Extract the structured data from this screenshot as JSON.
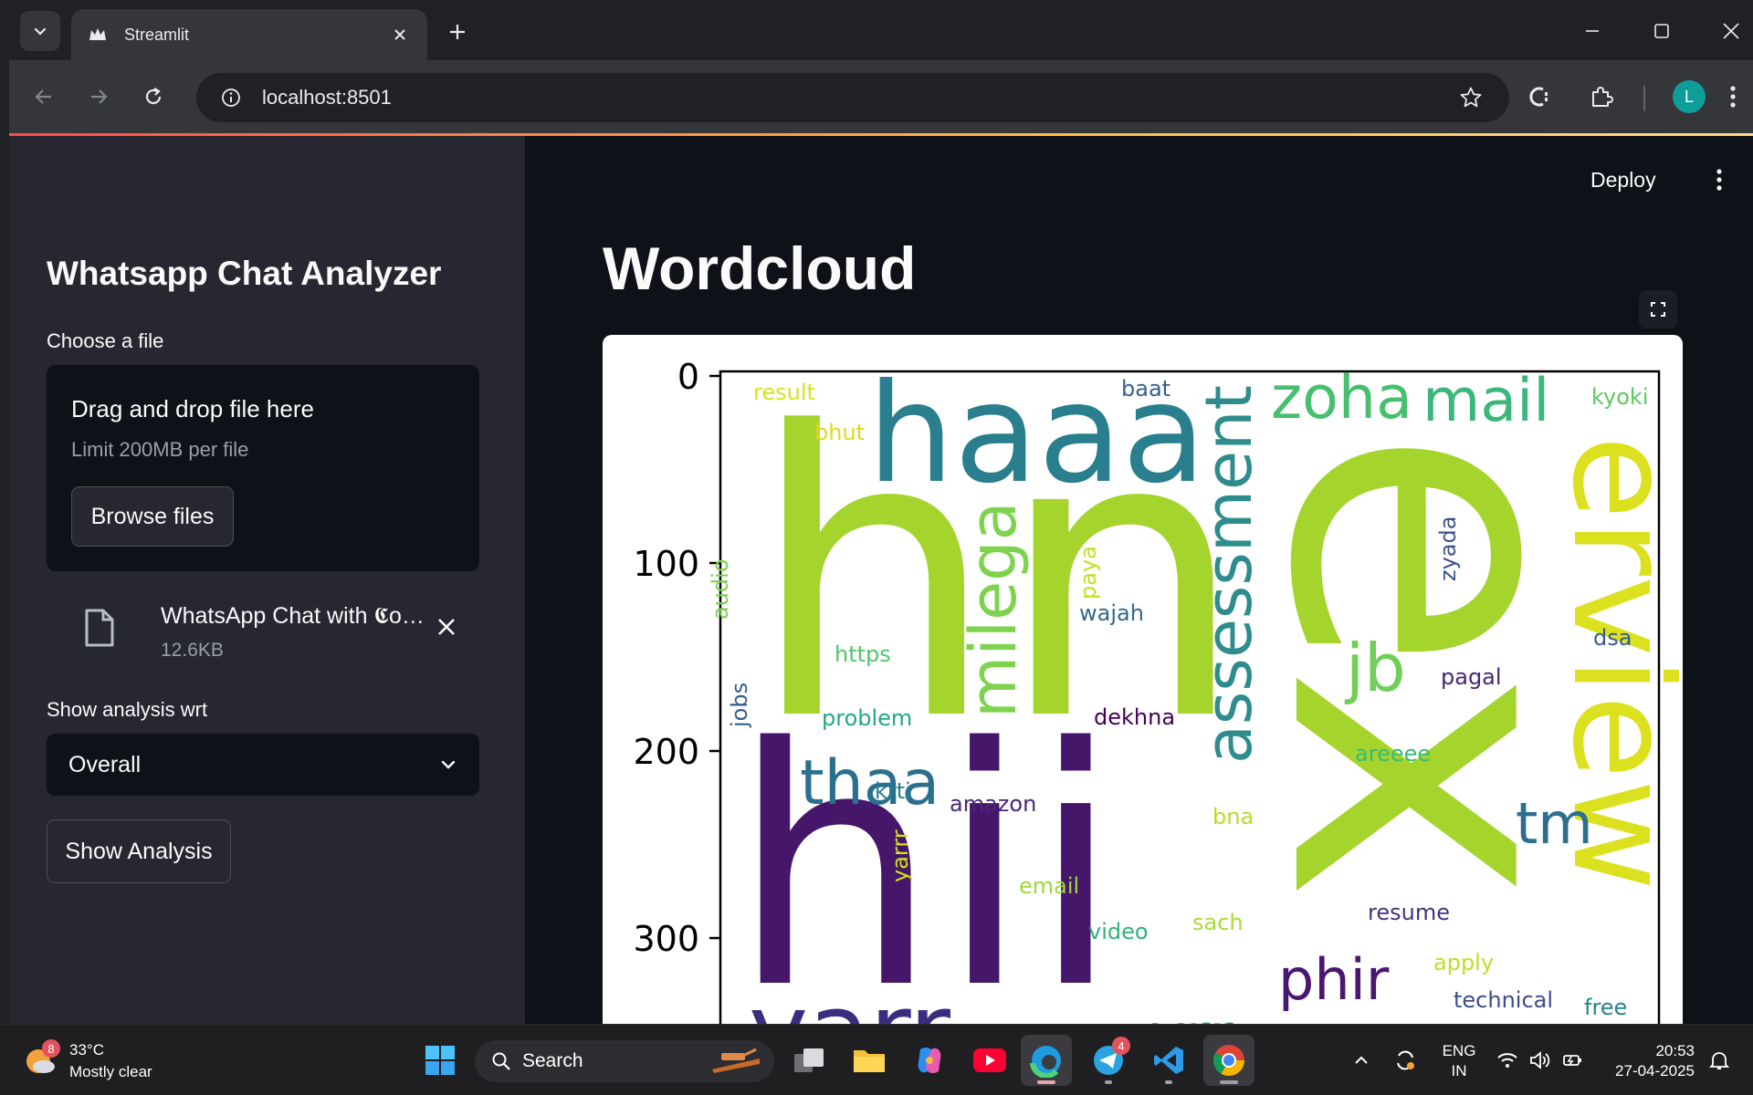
{
  "browser": {
    "tab_title": "Streamlit",
    "url": "localhost:8501",
    "profile_initial": "L"
  },
  "sidebar": {
    "title": "Whatsapp Chat Analyzer",
    "file_label": "Choose a file",
    "dropzone_title": "Drag and drop file here",
    "dropzone_limit": "Limit 200MB per file",
    "browse_label": "Browse files",
    "uploaded_file_name": "WhatsApp Chat with 𝕮o…",
    "uploaded_file_size": "12.6KB",
    "analysis_label": "Show analysis wrt",
    "analysis_selected": "Overall",
    "show_button": "Show Analysis"
  },
  "main": {
    "deploy_label": "Deploy",
    "page_title": "Wordcloud",
    "y_ticks": [
      "0",
      "100",
      "200",
      "300"
    ],
    "words": [
      {
        "text": "hn",
        "color": "#a5d42d",
        "rotate": 0
      },
      {
        "text": "haaa",
        "color": "#2a7f8e",
        "rotate": 0
      },
      {
        "text": "hii",
        "color": "#46166b",
        "rotate": 0
      },
      {
        "text": "ex",
        "color": "#a5d42d",
        "rotate": 90
      },
      {
        "text": "erview",
        "color": "#dce11f",
        "rotate": 90
      },
      {
        "text": "zoha",
        "color": "#46c06f",
        "rotate": 0
      },
      {
        "text": "mail",
        "color": "#3bb77a",
        "rotate": 0
      },
      {
        "text": "assessment",
        "color": "#2f8c8c",
        "rotate": -90
      },
      {
        "text": "milega",
        "color": "#7ed34e",
        "rotate": -90
      },
      {
        "text": "thaa",
        "color": "#2b6f8e",
        "rotate": 0
      },
      {
        "text": "jb",
        "color": "#6fcf57",
        "rotate": 0
      },
      {
        "text": "tm",
        "color": "#2d6e8d",
        "rotate": 0
      },
      {
        "text": "phir",
        "color": "#4a1770",
        "rotate": 0
      },
      {
        "text": "yarr",
        "color": "#3a2d7f",
        "rotate": 0
      },
      {
        "text": "yrr",
        "color": "#2aa083",
        "rotate": 0
      },
      {
        "text": "result",
        "color": "#d8e219",
        "rotate": 0
      },
      {
        "text": "bhut",
        "color": "#e0d81c",
        "rotate": 0
      },
      {
        "text": "baat",
        "color": "#35608d",
        "rotate": 0
      },
      {
        "text": "kyoki",
        "color": "#5ec962",
        "rotate": 0
      },
      {
        "text": "zyada",
        "color": "#3b528b",
        "rotate": -90
      },
      {
        "text": "paya",
        "color": "#c2df23",
        "rotate": -90
      },
      {
        "text": "wajah",
        "color": "#31688e",
        "rotate": 0
      },
      {
        "text": "audio",
        "color": "#7ad151",
        "rotate": -90
      },
      {
        "text": "https",
        "color": "#52c569",
        "rotate": 0
      },
      {
        "text": "dsa",
        "color": "#38598c",
        "rotate": 0
      },
      {
        "text": "pagal",
        "color": "#482475",
        "rotate": 0
      },
      {
        "text": "jobs",
        "color": "#355f8d",
        "rotate": -90
      },
      {
        "text": "problem",
        "color": "#22a884",
        "rotate": 0
      },
      {
        "text": "dekhna",
        "color": "#440154",
        "rotate": 0
      },
      {
        "text": "krti",
        "color": "#287d8e",
        "rotate": 0
      },
      {
        "text": "areeee",
        "color": "#3aba76",
        "rotate": 0
      },
      {
        "text": "amazon",
        "color": "#482878",
        "rotate": 0
      },
      {
        "text": "bna",
        "color": "#b5de2b",
        "rotate": 0
      },
      {
        "text": "yarrr",
        "color": "#d2e21b",
        "rotate": -90
      },
      {
        "text": "email",
        "color": "#9bd93c",
        "rotate": 0
      },
      {
        "text": "sach",
        "color": "#a8db34",
        "rotate": 0
      },
      {
        "text": "video",
        "color": "#2eb37c",
        "rotate": 0
      },
      {
        "text": "resume",
        "color": "#46327e",
        "rotate": 0
      },
      {
        "text": "apply",
        "color": "#bddf26",
        "rotate": 0
      },
      {
        "text": "technical",
        "color": "#3e4a89",
        "rotate": 0
      },
      {
        "text": "free",
        "color": "#25838e",
        "rotate": 0
      }
    ]
  },
  "taskbar": {
    "weather_badge": "8",
    "temperature": "33°C",
    "condition": "Mostly clear",
    "search_placeholder": "Search",
    "telegram_badge": "4",
    "lang_line1": "ENG",
    "lang_line2": "IN",
    "time": "20:53",
    "date": "27-04-2025"
  }
}
